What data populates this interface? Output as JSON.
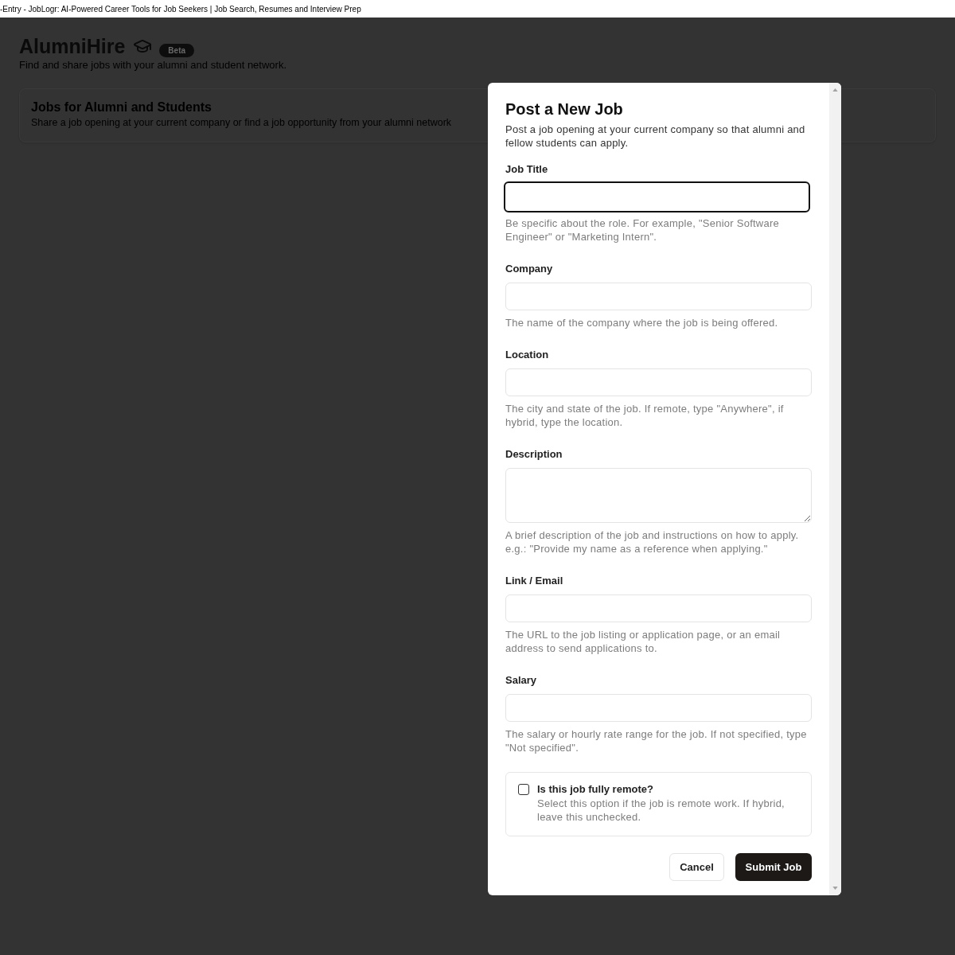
{
  "browser": {
    "tab_title": "-Entry - JobLogr: AI-Powered Career Tools for Job Seekers | Job Search, Resumes and Interview Prep"
  },
  "page": {
    "title": "AlumniHire",
    "badge": "Beta",
    "subtitle": "Find and share jobs with your alumni and student network.",
    "card": {
      "title": "Jobs for Alumni and Students",
      "description": "Share a job opening at your current company or find a job opportunity from your alumni network"
    }
  },
  "dialog": {
    "title": "Post a New Job",
    "description": "Post a job opening at your current company so that alumni and fellow students can apply.",
    "fields": [
      {
        "kind": "input",
        "label": "Job Title",
        "focused": true,
        "help": "Be specific about the role. For example, \"Senior Software Engineer\" or \"Marketing Intern\"."
      },
      {
        "kind": "input",
        "label": "Company",
        "focused": false,
        "help": "The name of the company where the job is being offered."
      },
      {
        "kind": "input",
        "label": "Location",
        "focused": false,
        "help": "The city and state of the job. If remote, type \"Anywhere\", if hybrid, type the location."
      },
      {
        "kind": "textarea",
        "label": "Description",
        "focused": false,
        "help": "A brief description of the job and instructions on how to apply. e.g.: \"Provide my name as a reference when applying.\""
      },
      {
        "kind": "input",
        "label": "Link / Email",
        "focused": false,
        "help": "The URL to the job listing or application page, or an email address to send applications to."
      },
      {
        "kind": "input",
        "label": "Salary",
        "focused": false,
        "help": "The salary or hourly rate range for the job. If not specified, type \"Not specified\"."
      }
    ],
    "remote_option": {
      "label": "Is this job fully remote?",
      "description": "Select this option if the job is remote work. If hybrid, leave this unchecked.",
      "checked": false
    },
    "buttons": [
      {
        "kind": "outline",
        "label": "Cancel"
      },
      {
        "kind": "primary",
        "label": "Submit Job"
      }
    ]
  }
}
